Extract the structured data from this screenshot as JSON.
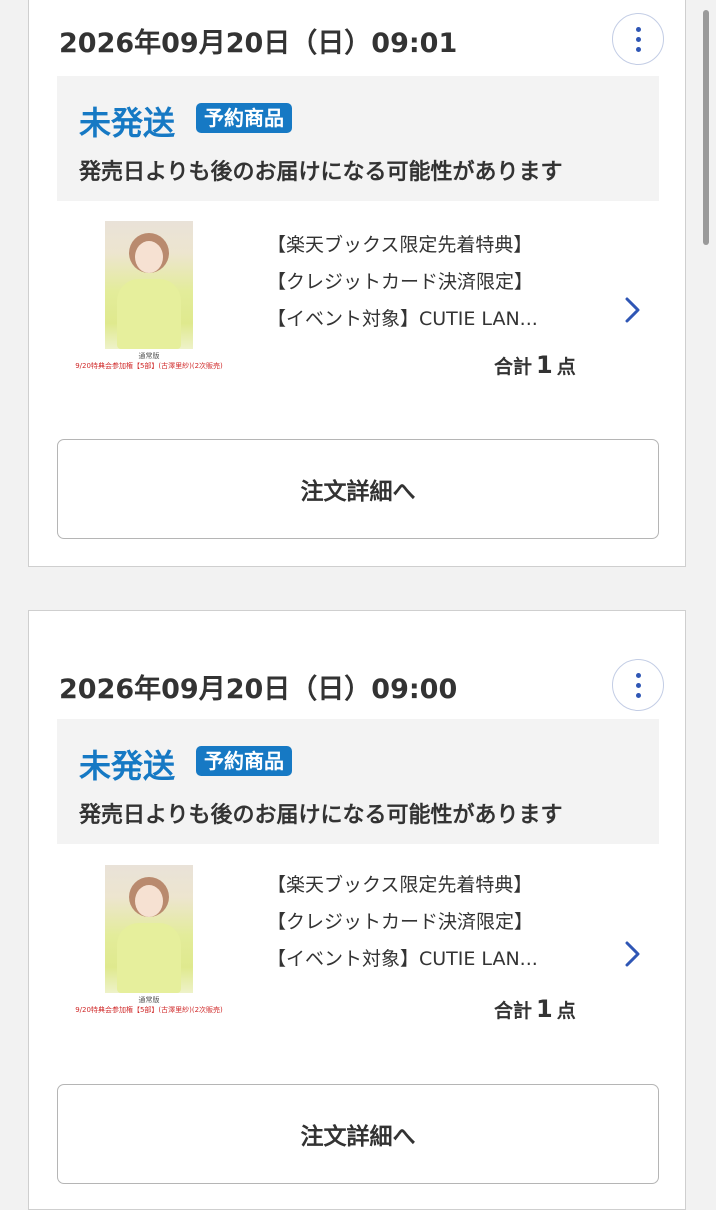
{
  "orders": [
    {
      "datetime": "2026年09月20日（日）09:01",
      "status": "未発送",
      "badge": "予約商品",
      "notice": "発売日よりも後のお届けになる可能性があります",
      "item": {
        "line1": "【楽天ブックス限定先着特典】",
        "line2": "【クレジットカード決済限定】",
        "line3": "【イベント対象】CUTIE LAN...",
        "image_caption1": "通常版",
        "image_caption2": "9/20特典会参加権【5部】(古澤里紗)(2次販売)"
      },
      "total_prefix": "合計",
      "total_count": "1",
      "total_suffix": "点",
      "detail_button": "注文詳細へ"
    },
    {
      "datetime": "2026年09月20日（日）09:00",
      "status": "未発送",
      "badge": "予約商品",
      "notice": "発売日よりも後のお届けになる可能性があります",
      "item": {
        "line1": "【楽天ブックス限定先着特典】",
        "line2": "【クレジットカード決済限定】",
        "line3": "【イベント対象】CUTIE LAN...",
        "image_caption1": "通常版",
        "image_caption2": "9/20特典会参加権【5部】(古澤里紗)(2次販売)"
      },
      "total_prefix": "合計",
      "total_count": "1",
      "total_suffix": "点",
      "detail_button": "注文詳細へ"
    }
  ],
  "colors": {
    "status_blue": "#1679c4",
    "menu_dot": "#2f56b5",
    "chevron": "#2f56b5"
  }
}
